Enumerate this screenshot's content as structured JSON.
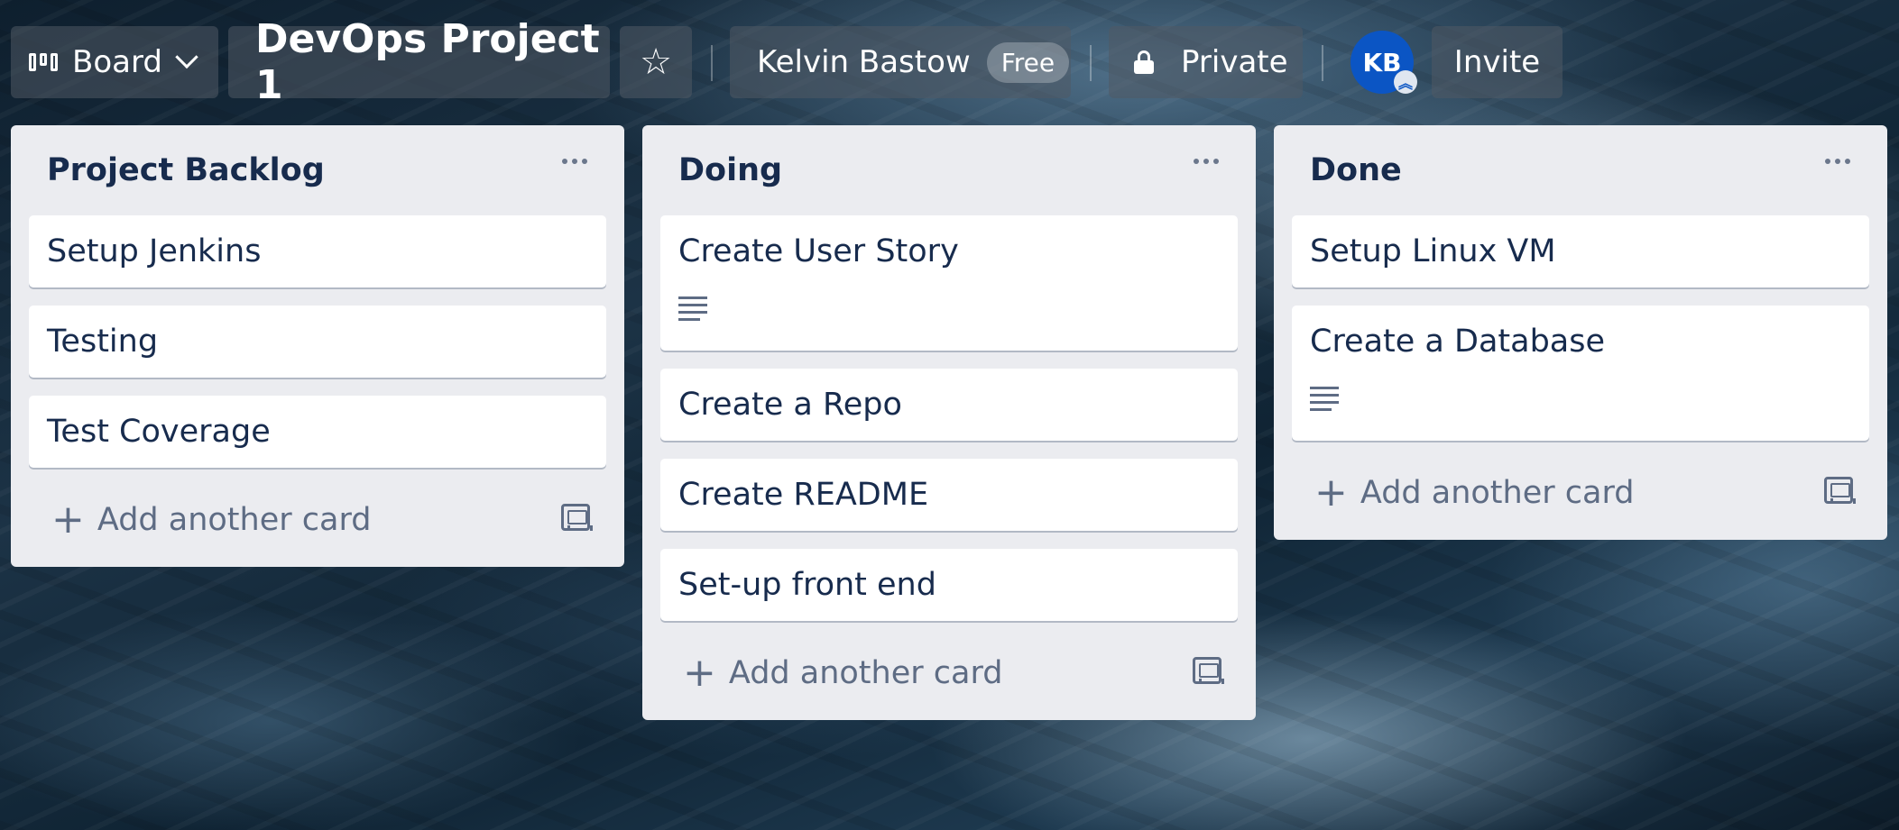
{
  "header": {
    "view_label": "Board",
    "board_title": "DevOps Project 1",
    "owner_name": "Kelvin Bastow",
    "plan_badge": "Free",
    "visibility": "Private",
    "avatar_initials": "KB",
    "invite_label": "Invite",
    "star_icon": "star-icon",
    "lock_icon": "lock-icon"
  },
  "lists": [
    {
      "title": "Project Backlog",
      "cards": [
        {
          "title": "Setup Jenkins",
          "has_description": false
        },
        {
          "title": "Testing",
          "has_description": false
        },
        {
          "title": "Test Coverage",
          "has_description": false
        }
      ],
      "add_card_label": "Add another card"
    },
    {
      "title": "Doing",
      "cards": [
        {
          "title": "Create User Story",
          "has_description": true
        },
        {
          "title": "Create a Repo",
          "has_description": false
        },
        {
          "title": "Create README",
          "has_description": false
        },
        {
          "title": "Set-up front end",
          "has_description": false
        }
      ],
      "add_card_label": "Add another card"
    },
    {
      "title": "Done",
      "cards": [
        {
          "title": "Setup Linux VM",
          "has_description": false
        },
        {
          "title": "Create a Database",
          "has_description": true
        }
      ],
      "add_card_label": "Add another card"
    }
  ],
  "colors": {
    "list_background": "#ebecf0",
    "card_text": "#172b4d",
    "muted_text": "#5e6c84",
    "avatar_blue": "#0b55c4"
  }
}
